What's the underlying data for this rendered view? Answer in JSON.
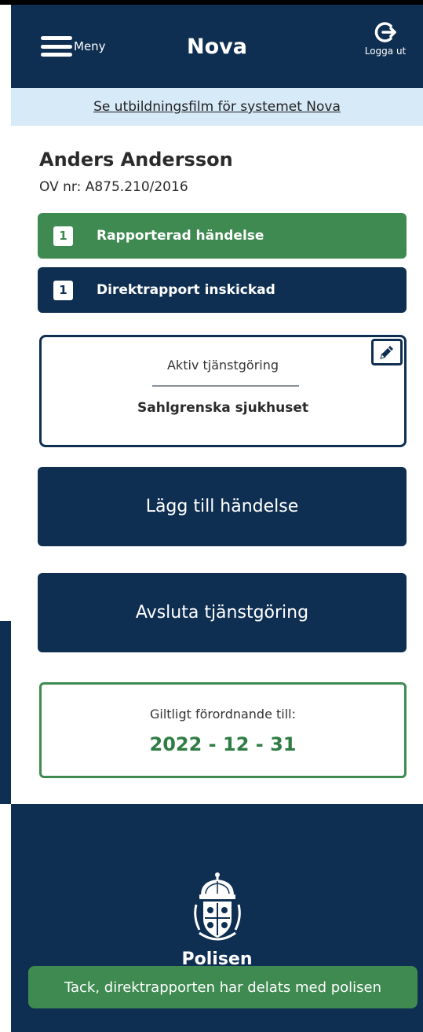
{
  "header": {
    "menu_label": "Meny",
    "app_title": "Nova",
    "logout_label": "Logga ut"
  },
  "banner": {
    "link_text": "Se utbildningsfilm för systemet Nova"
  },
  "user": {
    "name": "Anders Andersson",
    "ov_number": "OV nr: A875.210/2016"
  },
  "status": {
    "reported": {
      "count": "1",
      "label": "Rapporterad händelse",
      "color": "#3e8a50"
    },
    "direct_report": {
      "count": "1",
      "label": "Direktrapport inskickad",
      "color": "#0f2f52"
    }
  },
  "service": {
    "heading": "Aktiv tjänstgöring",
    "place": "Sahlgrenska sjukhuset",
    "edit_icon": "pencil-icon"
  },
  "actions": {
    "add_event": "Lägg till händelse",
    "end_service": "Avsluta tjänstgöring"
  },
  "validity": {
    "label": "Giltligt förordnande till:",
    "date": "2022 - 12 - 31"
  },
  "footer": {
    "brand": "Polisen",
    "logo_icon": "police-crest-icon"
  },
  "toast": {
    "message": "Tack, direktrapporten har delats med polisen"
  },
  "colors": {
    "navy": "#0f2f52",
    "green": "#3e8a50",
    "banner_bg": "#d7eaf8"
  }
}
